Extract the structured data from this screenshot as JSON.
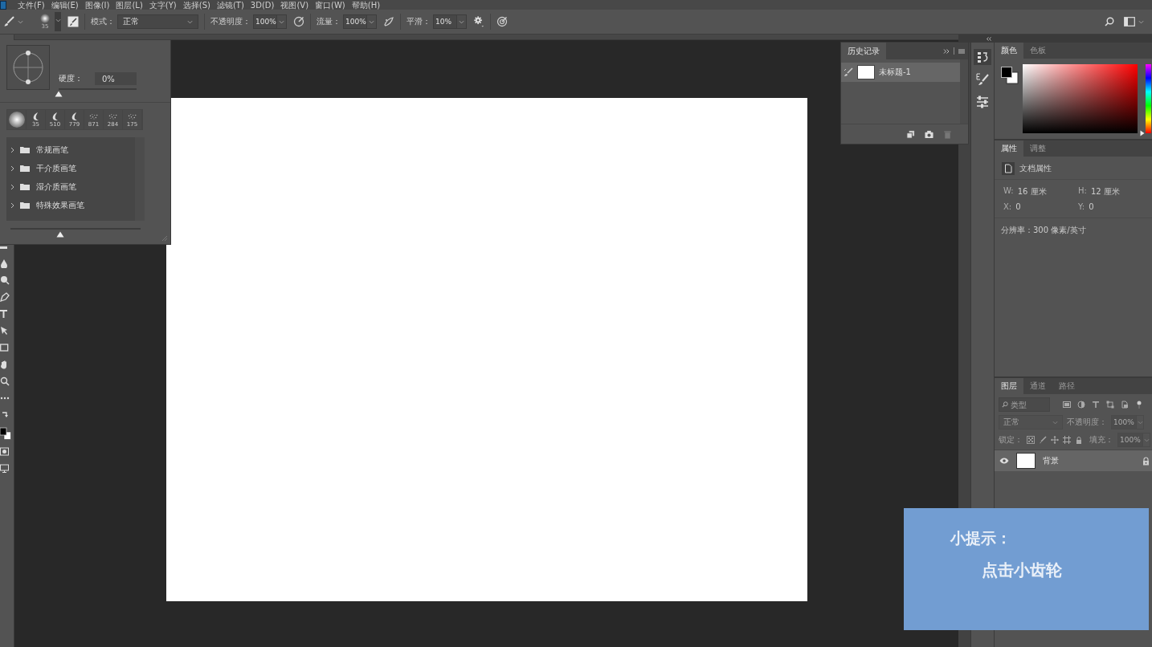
{
  "menu_bar": {
    "items": [
      "文件(F)",
      "编辑(E)",
      "图像(I)",
      "图层(L)",
      "文字(Y)",
      "选择(S)",
      "滤镜(T)",
      "3D(D)",
      "视图(V)",
      "窗口(W)",
      "帮助(H)"
    ]
  },
  "options_bar": {
    "brush_size": "35",
    "mode": {
      "label": "模式：",
      "value": "正常"
    },
    "opacity": {
      "label": "不透明度：",
      "value": "100%"
    },
    "flow": {
      "label": "流量：",
      "value": "100%"
    },
    "smoothing": {
      "label": "平滑：",
      "value": "10%"
    }
  },
  "brush_panel": {
    "hardness": {
      "label": "硬度：",
      "value": "0%",
      "level": 0
    },
    "presets": [
      {
        "kind": "soft-round"
      },
      {
        "kind": "stroke",
        "size": "35"
      },
      {
        "kind": "stroke",
        "size": "510"
      },
      {
        "kind": "stroke",
        "size": "779"
      },
      {
        "kind": "spray",
        "size": "871"
      },
      {
        "kind": "spray",
        "size": "284"
      },
      {
        "kind": "spray",
        "size": "175"
      }
    ],
    "folders": [
      {
        "name": "常规画笔",
        "expanded": false
      },
      {
        "name": "干介质画笔",
        "expanded": false
      },
      {
        "name": "湿介质画笔",
        "expanded": false
      },
      {
        "name": "特殊效果画笔",
        "expanded": false
      }
    ],
    "preview_size": {
      "level": 0.38
    }
  },
  "history_panel": {
    "tab": "历史记录",
    "states": [
      {
        "name": "未标题-1",
        "selected": true
      }
    ]
  },
  "color_panel": {
    "tabs": [
      {
        "label": "颜色",
        "selected": true
      },
      {
        "label": "色板",
        "selected": false
      }
    ],
    "hue_slider": {
      "level": 0
    }
  },
  "properties_panel": {
    "tabs": [
      {
        "label": "属性",
        "selected": true
      },
      {
        "label": "调整",
        "selected": false
      }
    ],
    "title": "文档属性",
    "fields": [
      {
        "label": "W:",
        "value": "16 厘米"
      },
      {
        "label": "H:",
        "value": "12 厘米"
      },
      {
        "label": "X:",
        "value": "0"
      },
      {
        "label": "Y:",
        "value": "0"
      }
    ],
    "resolution": "分辨率：300 像素/英寸"
  },
  "layers_panel": {
    "tabs": [
      {
        "label": "图层",
        "selected": true
      },
      {
        "label": "通道",
        "selected": false
      },
      {
        "label": "路径",
        "selected": false
      }
    ],
    "filter": {
      "placeholder": "类型"
    },
    "blend_mode": {
      "value": "正常",
      "disabled": true
    },
    "opacity": {
      "label": "不透明度：",
      "value": "100%",
      "disabled": true
    },
    "lock_label": "锁定：",
    "fill": {
      "label": "填充：",
      "value": "100%",
      "disabled": true
    },
    "layers": [
      {
        "name": "背景",
        "visible": true,
        "locked": true,
        "selected": true
      }
    ]
  },
  "tip": {
    "title": "小提示：",
    "text": "点击小齿轮"
  }
}
